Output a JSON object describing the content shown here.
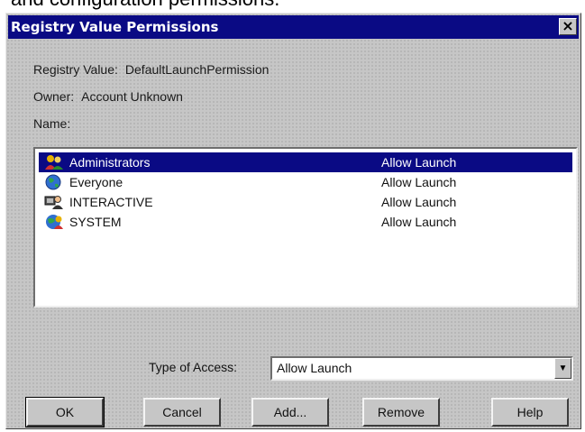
{
  "page_caption": "and configuration permissions.",
  "dialog": {
    "title": "Registry Value Permissions",
    "close_glyph": "×",
    "registry_value_label": "Registry Value:",
    "registry_value": "DefaultLaunchPermission",
    "owner_label": "Owner:",
    "owner": "Account Unknown",
    "name_label": "Name:"
  },
  "permissions": [
    {
      "name": "Administrators",
      "access": "Allow Launch",
      "icon": "users-group-icon",
      "selected": true
    },
    {
      "name": "Everyone",
      "access": "Allow Launch",
      "icon": "globe-icon",
      "selected": false
    },
    {
      "name": "INTERACTIVE",
      "access": "Allow Launch",
      "icon": "interactive-user-icon",
      "selected": false
    },
    {
      "name": "SYSTEM",
      "access": "Allow Launch",
      "icon": "system-group-icon",
      "selected": false
    }
  ],
  "type_of_access": {
    "label": "Type of Access:",
    "selected": "Allow Launch"
  },
  "buttons": {
    "ok": "OK",
    "cancel": "Cancel",
    "add": "Add...",
    "remove": "Remove",
    "help": "Help"
  },
  "colors": {
    "titlebar": "#0a0a84",
    "selection": "#0a0a84",
    "dialog_face": "#c6c6c6"
  }
}
